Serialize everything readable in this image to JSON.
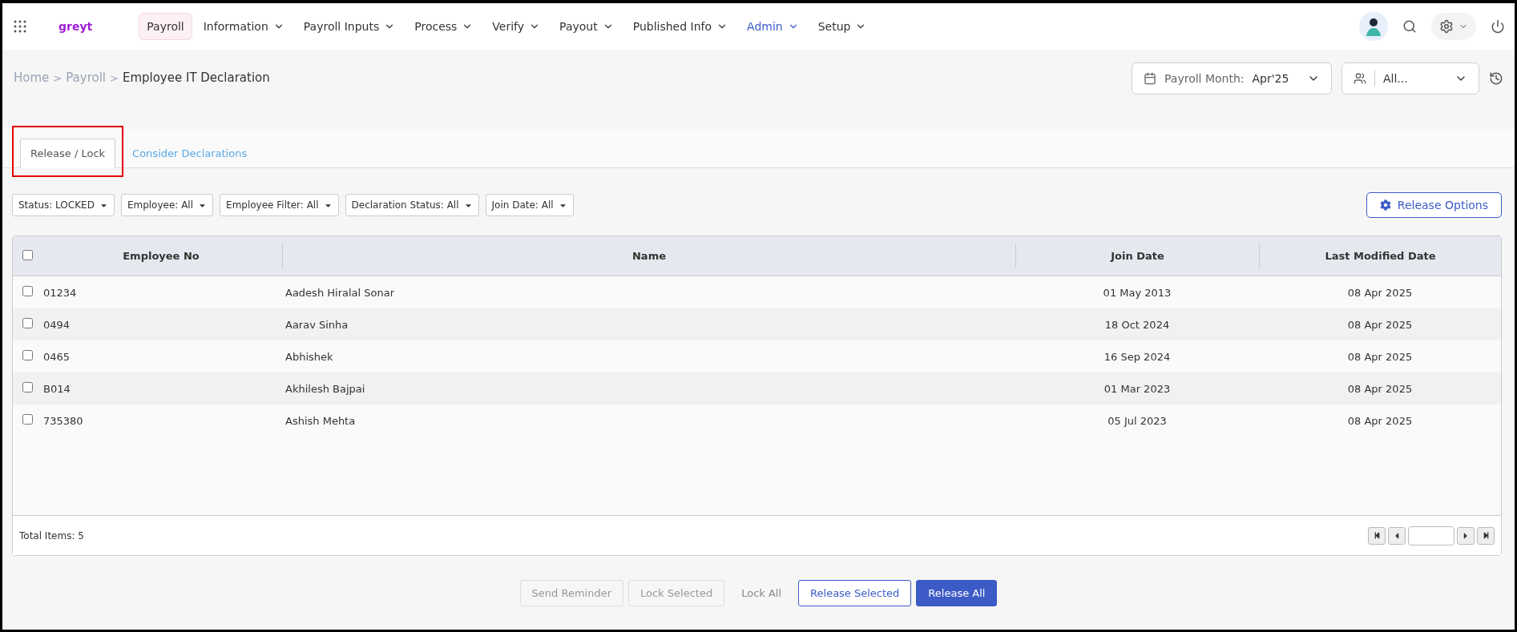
{
  "header": {
    "logo": "greyt",
    "nav": [
      {
        "label": "Payroll",
        "selected": false,
        "highlighted": true,
        "dropdown": false
      },
      {
        "label": "Information",
        "selected": false,
        "highlighted": false,
        "dropdown": true
      },
      {
        "label": "Payroll Inputs",
        "selected": false,
        "highlighted": false,
        "dropdown": true
      },
      {
        "label": "Process",
        "selected": false,
        "highlighted": false,
        "dropdown": true
      },
      {
        "label": "Verify",
        "selected": false,
        "highlighted": false,
        "dropdown": true
      },
      {
        "label": "Payout",
        "selected": false,
        "highlighted": false,
        "dropdown": true
      },
      {
        "label": "Published Info",
        "selected": false,
        "highlighted": false,
        "dropdown": true
      },
      {
        "label": "Admin",
        "selected": true,
        "highlighted": false,
        "dropdown": true
      },
      {
        "label": "Setup",
        "selected": false,
        "highlighted": false,
        "dropdown": true
      }
    ]
  },
  "breadcrumb": [
    {
      "label": "Home",
      "current": false
    },
    {
      "label": ">",
      "kind": "sep"
    },
    {
      "label": "Payroll",
      "current": false
    },
    {
      "label": ">",
      "kind": "sep"
    },
    {
      "label": "Employee IT Declaration",
      "current": true
    }
  ],
  "payroll_month": {
    "label": "Payroll Month:",
    "value": "Apr'25"
  },
  "employee_group": {
    "value": "All..."
  },
  "tabs": [
    {
      "label": "Release / Lock",
      "selected": true,
      "highlighted": true
    },
    {
      "label": "Consider Declarations",
      "selected": false,
      "highlighted": false
    }
  ],
  "filters": [
    "Status: LOCKED",
    "Employee: All",
    "Employee Filter: All",
    "Declaration Status: All",
    "Join Date: All"
  ],
  "release_options": "Release Options",
  "table": {
    "all_checked": false,
    "columns": [
      "Employee No",
      "Name",
      "Join Date",
      "Last Modified Date"
    ],
    "rows": [
      {
        "checked": false,
        "cells": [
          "01234",
          "Aadesh Hiralal Sonar",
          "01 May 2013",
          "08 Apr 2025"
        ]
      },
      {
        "checked": false,
        "cells": [
          "0494",
          "Aarav Sinha",
          "18 Oct 2024",
          "08 Apr 2025"
        ]
      },
      {
        "checked": false,
        "cells": [
          "0465",
          "Abhishek",
          "16 Sep 2024",
          "08 Apr 2025"
        ]
      },
      {
        "checked": false,
        "cells": [
          "B014",
          "Akhilesh Bajpai",
          "01 Mar 2023",
          "08 Apr 2025"
        ]
      },
      {
        "checked": false,
        "cells": [
          "735380",
          "Ashish Mehta",
          "05 Jul 2023",
          "08 Apr 2025"
        ]
      }
    ],
    "total": "Total Items: 5"
  },
  "actions": [
    {
      "label": "Send Reminder",
      "kind": "disabled"
    },
    {
      "label": "Lock Selected",
      "kind": "disabled"
    },
    {
      "label": "Lock All",
      "kind": "text"
    },
    {
      "label": "Release Selected",
      "kind": "outline"
    },
    {
      "label": "Release All",
      "kind": "primary"
    }
  ]
}
